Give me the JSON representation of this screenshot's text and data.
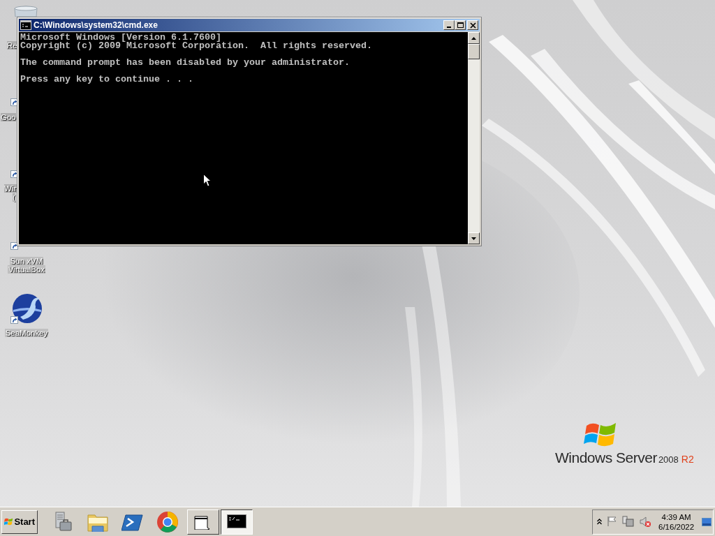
{
  "desktop_icons": [
    {
      "kind": "recycle",
      "lines": [
        "Re"
      ]
    },
    {
      "kind": "hidden",
      "lines": [
        "Goo"
      ]
    },
    {
      "kind": "hidden",
      "lines": [
        "Win",
        "("
      ]
    },
    {
      "kind": "virtualbox",
      "lines": [
        "Sun xVM",
        "VirtualBox"
      ]
    },
    {
      "kind": "seamonkey",
      "lines": [
        "SeaMonkey"
      ]
    }
  ],
  "window": {
    "title": "C:\\Windows\\system32\\cmd.exe",
    "paragraphs": [
      [
        "Microsoft Windows [Version 6.1.7600]",
        "Copyright (c) 2009 Microsoft Corporation.  All rights reserved."
      ],
      [
        "The command prompt has been disabled by your administrator."
      ],
      [
        "Press any key to continue . . ."
      ]
    ]
  },
  "logo": {
    "name": "Windows Server",
    "version": "2008",
    "edition": "R2"
  },
  "taskbar": {
    "start": "Start",
    "pinned": [
      {
        "kind": "server"
      },
      {
        "kind": "folder"
      },
      {
        "kind": "shell"
      },
      {
        "kind": "browser"
      }
    ],
    "windows": [
      {
        "kind": "window",
        "selected": false
      },
      {
        "kind": "console",
        "selected": true
      }
    ],
    "clock": {
      "time": "4:39 AM",
      "date": "6/16/2022"
    }
  }
}
